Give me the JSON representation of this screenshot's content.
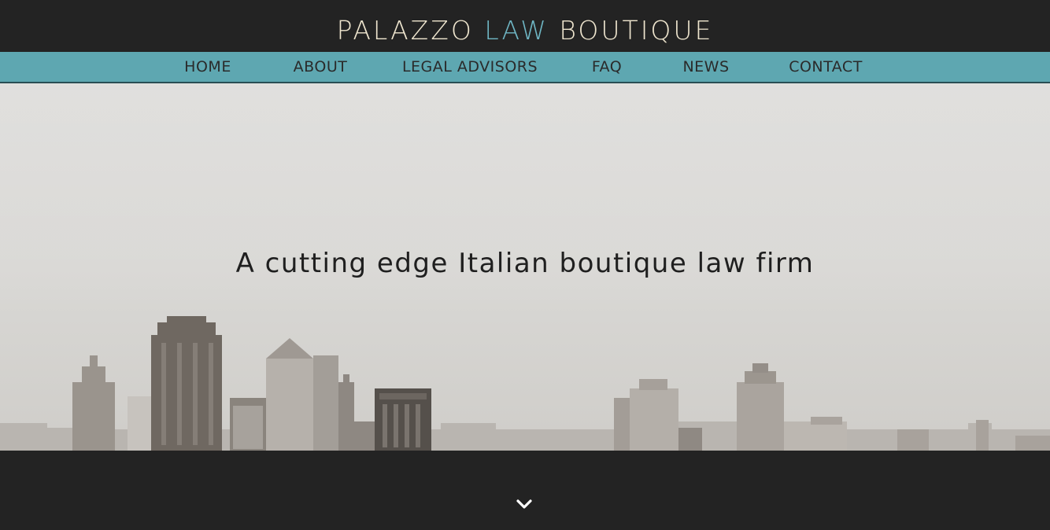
{
  "header": {
    "logo": {
      "word1": "PALAZZO",
      "word2": "LAW",
      "word3": "BOUTIQUE"
    }
  },
  "nav": {
    "items": [
      {
        "label": "HOME"
      },
      {
        "label": "ABOUT"
      },
      {
        "label": "LEGAL ADVISORS"
      },
      {
        "label": "FAQ"
      },
      {
        "label": "NEWS"
      },
      {
        "label": "CONTACT"
      }
    ]
  },
  "hero": {
    "tagline": "A cutting edge Italian boutique law firm"
  },
  "footer": {
    "scroll_icon": "chevron-down-icon"
  },
  "colors": {
    "background_dark": "#232323",
    "nav_teal": "#5ea7b1",
    "logo_cream": "#efe6cf",
    "logo_accent": "#6fb6c4"
  }
}
